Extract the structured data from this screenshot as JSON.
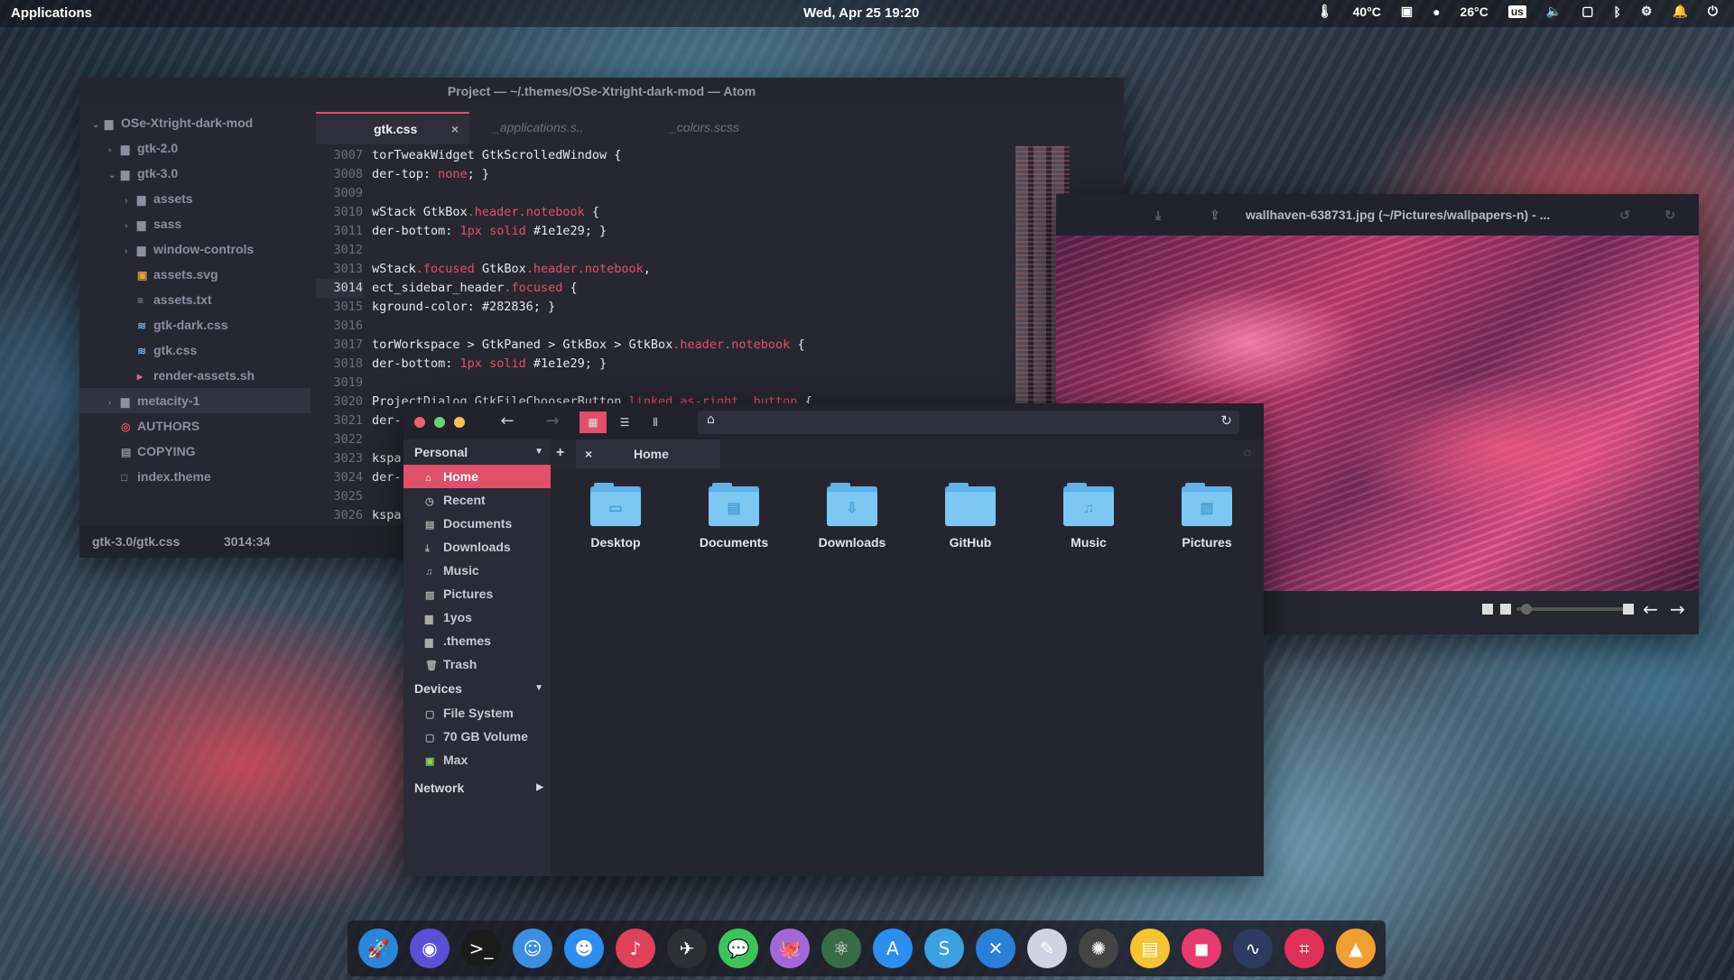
{
  "topbar": {
    "apps_label": "Applications",
    "clock": "Wed, Apr 25   19:20",
    "tray": {
      "cpu_temp": "40°C",
      "weather": "26°C",
      "keyboard_layout": "us"
    }
  },
  "atom": {
    "title": "Project — ~/.themes/OSe-Xtright-dark-mod — Atom",
    "tree": [
      {
        "label": "OSe-Xtright-dark-mod",
        "indent": 0,
        "arrow": "⌄",
        "icon": "folder-icon"
      },
      {
        "label": "gtk-2.0",
        "indent": 1,
        "arrow": "›",
        "icon": "folder-icon"
      },
      {
        "label": "gtk-3.0",
        "indent": 1,
        "arrow": "⌄",
        "icon": "folder-icon"
      },
      {
        "label": "assets",
        "indent": 2,
        "arrow": "›",
        "icon": "folder-icon"
      },
      {
        "label": "sass",
        "indent": 2,
        "arrow": "›",
        "icon": "folder-icon"
      },
      {
        "label": "window-controls",
        "indent": 2,
        "arrow": "›",
        "icon": "folder-icon"
      },
      {
        "label": "assets.svg",
        "indent": 2,
        "arrow": "",
        "icon": "image-file-icon"
      },
      {
        "label": "assets.txt",
        "indent": 2,
        "arrow": "",
        "icon": "text-file-icon"
      },
      {
        "label": "gtk-dark.css",
        "indent": 2,
        "arrow": "",
        "icon": "css-file-icon"
      },
      {
        "label": "gtk.css",
        "indent": 2,
        "arrow": "",
        "icon": "css-file-icon"
      },
      {
        "label": "render-assets.sh",
        "indent": 2,
        "arrow": "",
        "icon": "shell-file-icon"
      },
      {
        "label": "metacity-1",
        "indent": 1,
        "arrow": "›",
        "icon": "folder-icon"
      },
      {
        "label": "AUTHORS",
        "indent": 1,
        "arrow": "",
        "icon": "authors-file-icon"
      },
      {
        "label": "COPYING",
        "indent": 1,
        "arrow": "",
        "icon": "book-file-icon"
      },
      {
        "label": "index.theme",
        "indent": 1,
        "arrow": "",
        "icon": "file-icon"
      }
    ],
    "tabs": [
      {
        "label": "gtk.css",
        "close": "×"
      },
      {
        "label": "_applications.s.."
      },
      {
        "label": "_colors.scss"
      }
    ],
    "code": [
      {
        "n": "3007",
        "t": "torTweakWidget GtkScrolledWindow {"
      },
      {
        "n": "3008",
        "t": "der-top: none; }"
      },
      {
        "n": "3009",
        "t": ""
      },
      {
        "n": "3010",
        "t": "wStack GtkBox.header.notebook {"
      },
      {
        "n": "3011",
        "t": "der-bottom: 1px solid #1e1e29; }"
      },
      {
        "n": "3012",
        "t": ""
      },
      {
        "n": "3013",
        "t": "wStack.focused GtkBox.header.notebook,"
      },
      {
        "n": "3014",
        "t": "ect_sidebar_header.focused {"
      },
      {
        "n": "3015",
        "t": "kground-color: #282836; }"
      },
      {
        "n": "3016",
        "t": ""
      },
      {
        "n": "3017",
        "t": "torWorkspace > GtkPaned > GtkBox > GtkBox.header.notebook {"
      },
      {
        "n": "3018",
        "t": "der-bottom: 1px solid #1e1e29; }"
      },
      {
        "n": "3019",
        "t": ""
      },
      {
        "n": "3020",
        "t": "ProjectDialog GtkFileChooserButton.linked.as-right .button {"
      },
      {
        "n": "3021",
        "t": "der-"
      },
      {
        "n": "3022",
        "t": ""
      },
      {
        "n": "3023",
        "t": "kspa"
      },
      {
        "n": "3024",
        "t": "der-"
      },
      {
        "n": "3025",
        "t": ""
      },
      {
        "n": "3026",
        "t": "kspa"
      },
      {
        "n": "3027",
        "t": ""
      }
    ],
    "status_path": "gtk-3.0/gtk.css",
    "status_pos": "3014:34"
  },
  "viewer": {
    "title": "wallhaven-638731.jpg (~/Pictures/wallpapers-n) - ...",
    "zoom_fraction": 0.05
  },
  "files": {
    "sidebar": {
      "personal_header": "Personal",
      "personal": [
        {
          "label": "Home",
          "icon": "home-icon",
          "selected": true
        },
        {
          "label": "Recent",
          "icon": "clock-icon"
        },
        {
          "label": "Documents",
          "icon": "document-icon"
        },
        {
          "label": "Downloads",
          "icon": "download-icon"
        },
        {
          "label": "Music",
          "icon": "music-icon"
        },
        {
          "label": "Pictures",
          "icon": "picture-icon"
        },
        {
          "label": "1yos",
          "icon": "folder-icon"
        },
        {
          "label": ".themes",
          "icon": "folder-icon"
        },
        {
          "label": "Trash",
          "icon": "trash-icon"
        }
      ],
      "devices_header": "Devices",
      "devices": [
        {
          "label": "File System",
          "icon": "drive-icon"
        },
        {
          "label": "70 GB Volume",
          "icon": "drive-icon"
        },
        {
          "label": "Max",
          "icon": "usb-drive-icon"
        }
      ],
      "network_header": "Network"
    },
    "tab": {
      "label": "Home",
      "close": "×",
      "add": "+"
    },
    "folders": [
      {
        "label": "Desktop",
        "glyph": "▭"
      },
      {
        "label": "Documents",
        "glyph": "▤"
      },
      {
        "label": "Downloads",
        "glyph": "⇩"
      },
      {
        "label": "GitHub",
        "glyph": ""
      },
      {
        "label": "Music",
        "glyph": "♫"
      },
      {
        "label": "Pictures",
        "glyph": "▨"
      }
    ]
  },
  "dock": {
    "apps": [
      {
        "name": "launchpad-rocket",
        "color": "#2a86d9",
        "glyph": "🚀"
      },
      {
        "name": "firefox",
        "color": "#5b4fd6",
        "glyph": "◉"
      },
      {
        "name": "terminal",
        "color": "#1b1b1b",
        "glyph": ">_"
      },
      {
        "name": "finder-files",
        "color": "#3d8ee0",
        "glyph": "☺"
      },
      {
        "name": "finder",
        "color": "#2d8ef0",
        "glyph": "☻"
      },
      {
        "name": "itunes-music",
        "color": "#e0405a",
        "glyph": "♪"
      },
      {
        "name": "mail-paper-plane",
        "color": "#2e2e36",
        "glyph": "✈"
      },
      {
        "name": "messages",
        "color": "#3cc45a",
        "glyph": "💬"
      },
      {
        "name": "github-desktop",
        "color": "#a368d8",
        "glyph": "🐙"
      },
      {
        "name": "atom",
        "color": "#3a6b48",
        "glyph": "⚛"
      },
      {
        "name": "app-store",
        "color": "#2b8ff0",
        "glyph": "A"
      },
      {
        "name": "simplenote",
        "color": "#3aa0e0",
        "glyph": "S"
      },
      {
        "name": "xcode",
        "color": "#2a7fd6",
        "glyph": "✕"
      },
      {
        "name": "text-edit",
        "color": "#d0d4e0",
        "glyph": "✎"
      },
      {
        "name": "safari-compass",
        "color": "#444",
        "glyph": "✺"
      },
      {
        "name": "notes",
        "color": "#f5c430",
        "glyph": "▤"
      },
      {
        "name": "photo-booth",
        "color": "#e83a70",
        "glyph": "◼"
      },
      {
        "name": "activity-wave",
        "color": "#2f3a60",
        "glyph": "∿"
      },
      {
        "name": "crop-tool",
        "color": "#e0305a",
        "glyph": "⌗"
      },
      {
        "name": "image-viewer",
        "color": "#f0a030",
        "glyph": "▲"
      }
    ]
  }
}
